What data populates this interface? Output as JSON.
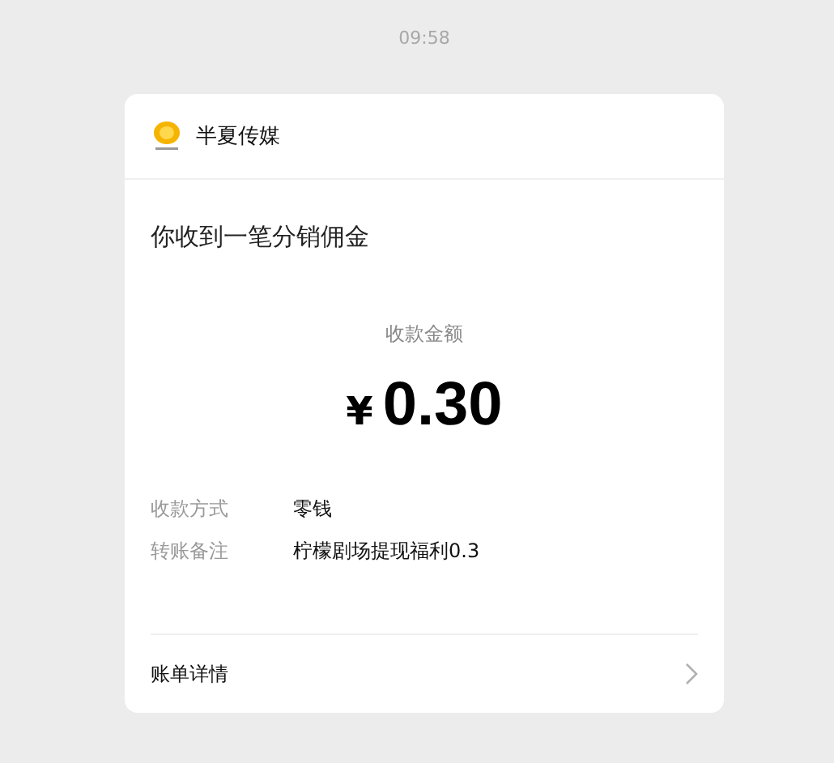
{
  "time": "09:58",
  "card": {
    "sender": "半夏传媒",
    "title": "你收到一笔分销佣金",
    "amount_label": "收款金额",
    "currency": "¥",
    "amount": "0.30",
    "details": [
      {
        "label": "收款方式",
        "value": "零钱"
      },
      {
        "label": "转账备注",
        "value": "柠檬剧场提现福利0.3"
      }
    ],
    "footer": "账单详情"
  }
}
